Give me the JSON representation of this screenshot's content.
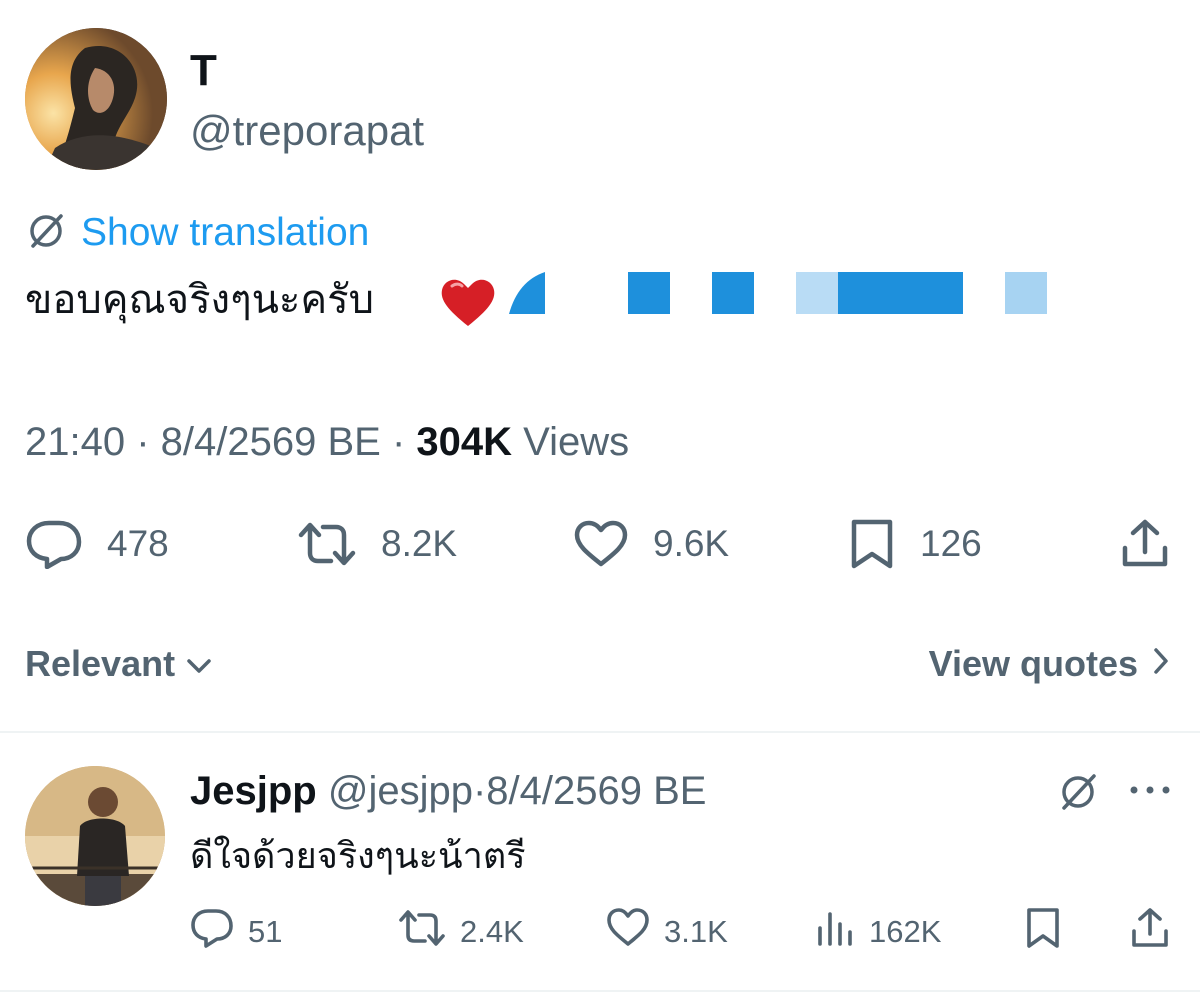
{
  "tweet": {
    "display_name": "T",
    "handle": "@treporapat",
    "translate_label": "Show translation",
    "text": "ขอบคุณจริงๆนะครับ",
    "time": "21:40",
    "date": "8/4/2569 BE",
    "views_count": "304K",
    "views_label": "Views",
    "stats": {
      "replies": "478",
      "retweets": "8.2K",
      "likes": "9.6K",
      "bookmarks": "126"
    }
  },
  "sort": {
    "label": "Relevant",
    "view_quotes": "View quotes"
  },
  "reply": {
    "display_name": "Jesjpp",
    "handle": "@jesjpp",
    "date": "8/4/2569 BE",
    "text": "ดีใจด้วยจริงๆนะน้าตรี",
    "stats": {
      "replies": "51",
      "retweets": "2.4K",
      "likes": "3.1K",
      "views": "162K"
    }
  },
  "colors": {
    "link_blue": "#1d9bf0",
    "secondary_text": "#536471",
    "primary_text": "#0f1419",
    "censor_blue": "#1e90dc"
  },
  "icons": [
    "translate-globe-icon",
    "reply-icon",
    "retweet-icon",
    "like-icon",
    "bookmark-icon",
    "share-icon",
    "chevron-down-icon",
    "chevron-right-icon",
    "more-icon",
    "views-icon",
    "heart-emoji-icon"
  ]
}
